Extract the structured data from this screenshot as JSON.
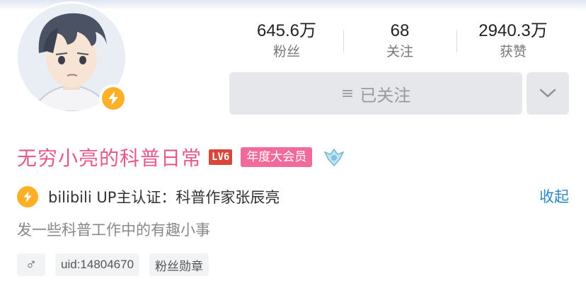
{
  "stats": [
    {
      "value": "645.6万",
      "label": "粉丝"
    },
    {
      "value": "68",
      "label": "关注"
    },
    {
      "value": "2940.3万",
      "label": "获赞"
    }
  ],
  "follow_button": {
    "label": "已关注",
    "icon": "menu-icon"
  },
  "more_button": {
    "icon": "chevron-down-icon"
  },
  "profile": {
    "username": "无穷小亮的科普日常",
    "level_badge": "LV6",
    "vip_badge": "年度大会员",
    "medal_icon": "medal-icon"
  },
  "verification": {
    "text": "bilibili  UP主认证：科普作家张辰亮",
    "collapse_label": "收起"
  },
  "bio": "发一些科普工作中的有趣小事",
  "tags": {
    "gender_symbol": "♂",
    "uid": "uid:14804670",
    "fan_medal": "粉丝勋章"
  },
  "colors": {
    "username": "#e8588a",
    "vip": "#f06b9a",
    "level": "#d9463a",
    "verify": "#ffb027",
    "link": "#2a86c6"
  }
}
